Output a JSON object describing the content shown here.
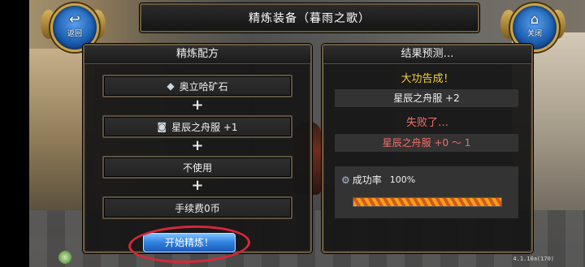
{
  "window": {
    "title": "精炼装备（暮雨之歌）"
  },
  "nav": {
    "back": {
      "icon": "back-arrow-icon",
      "glyph": "↩",
      "label": "返回"
    },
    "close": {
      "icon": "home-icon",
      "glyph": "⌂",
      "label": "关闭"
    }
  },
  "recipe": {
    "header": "精炼配方",
    "slots": [
      {
        "icon": "ore-icon",
        "glyph": "◆",
        "label": "奥立哈矿石"
      },
      {
        "icon": "armor-icon",
        "glyph": "◙",
        "label": "星辰之舟服 +1"
      },
      {
        "icon": "",
        "glyph": "",
        "label": "不使用"
      },
      {
        "icon": "",
        "glyph": "",
        "label": "手续费0币"
      }
    ],
    "plus": "+",
    "start_button": "开始精炼！"
  },
  "result": {
    "header": "结果预测…",
    "success_title": "大功告成！",
    "success_item": "星辰之舟服 +2",
    "fail_title": "失败了…",
    "fail_item": "星辰之舟服 +0 ～ 1",
    "rate_label": "成功率",
    "rate_value": "100%",
    "rate_fraction": 1.0
  },
  "version": "4.1.10a(170)",
  "colors": {
    "frame_gold": "#6a5a3f",
    "success_text": "#f1d13a",
    "fail_text": "#f0706a",
    "start_button": "#2f7fe0",
    "annotation_circle": "#d9263a"
  }
}
